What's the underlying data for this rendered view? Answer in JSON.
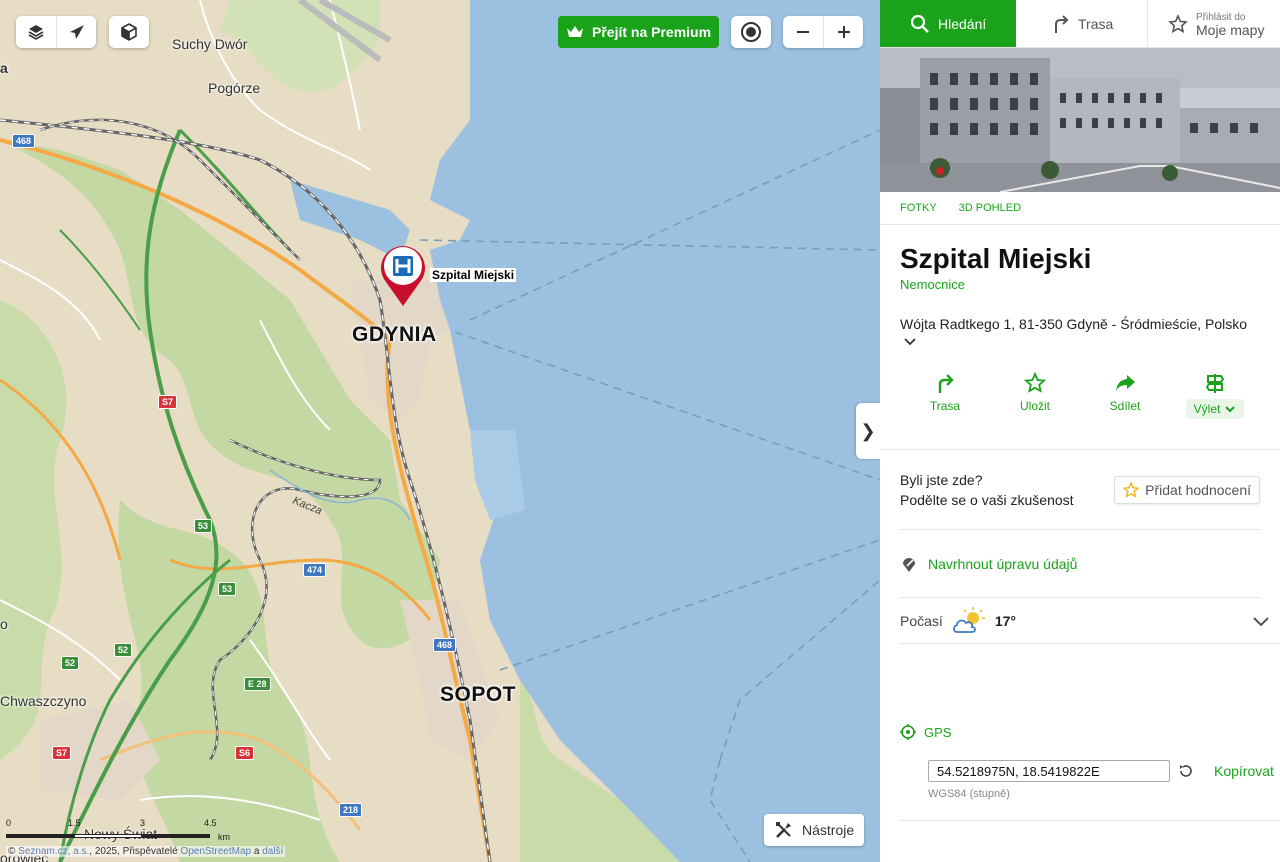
{
  "map": {
    "premium_label": "Přejít na Premium",
    "marker_label": "Szpital Miejski",
    "tools_label": "Nástroje",
    "collapse_symbol": "❯",
    "places": {
      "suchy_dwor": "Suchy Dwór",
      "pogorze": "Pogórze",
      "gdynia": "GDYNIA",
      "sopot": "SOPOT",
      "chwaszczyno": "Chwaszczyno",
      "nowy_swiat": "Nowy Świat",
      "kacza": "Kacza",
      "edge_a": "a",
      "edge_o": "o",
      "edge_bottom": "orowiec"
    },
    "roads": {
      "r468a": "468",
      "r468b": "468",
      "s7a": "S7",
      "s7b": "S7",
      "r474": "474",
      "r53a": "53",
      "r53b": "53",
      "r52a": "52",
      "r52b": "52",
      "e28": "E 28",
      "s6": "S6",
      "r218": "218"
    },
    "scale": {
      "t0": "0",
      "t1": "1.5",
      "t2": "3",
      "t3": "4.5",
      "unit": "km"
    },
    "copyright": {
      "prefix": "©",
      "seznam": "Seznam.cz, a.s.",
      "year": ", 2025, Přispěvatelé",
      "osm": "OpenStreetMap",
      "and": "a",
      "others": "další"
    }
  },
  "tabs": {
    "search": "Hledání",
    "route": "Trasa",
    "login_small": "Přihlásit do",
    "login_big": "Moje mapy"
  },
  "photo_tabs": {
    "photos": "FOTKY",
    "view3d": "3D POHLED"
  },
  "poi": {
    "title": "Szpital Miejski",
    "type": "Nemocnice",
    "address": "Wójta Radtkego 1, 81-350 Gdyně - Śródmieście, Polsko"
  },
  "actions": {
    "route": "Trasa",
    "save": "Uložit",
    "share": "Sdílet",
    "trip": "Výlet"
  },
  "review": {
    "line1": "Byli jste zde?",
    "line2": "Podělte se o vaši zkušenost",
    "button": "Přidat hodnocení"
  },
  "suggest_label": "Navrhnout úpravu údajů",
  "weather": {
    "label": "Počasí",
    "temp": "17°"
  },
  "gps": {
    "label": "GPS",
    "coords": "54.5218975N, 18.5419822E",
    "copy": "Kopírovat",
    "hint": "WGS84 (stupně)"
  },
  "colors": {
    "accent": "#1aa31a",
    "sea": "#9cc1e0",
    "marker": "#c8102e"
  }
}
